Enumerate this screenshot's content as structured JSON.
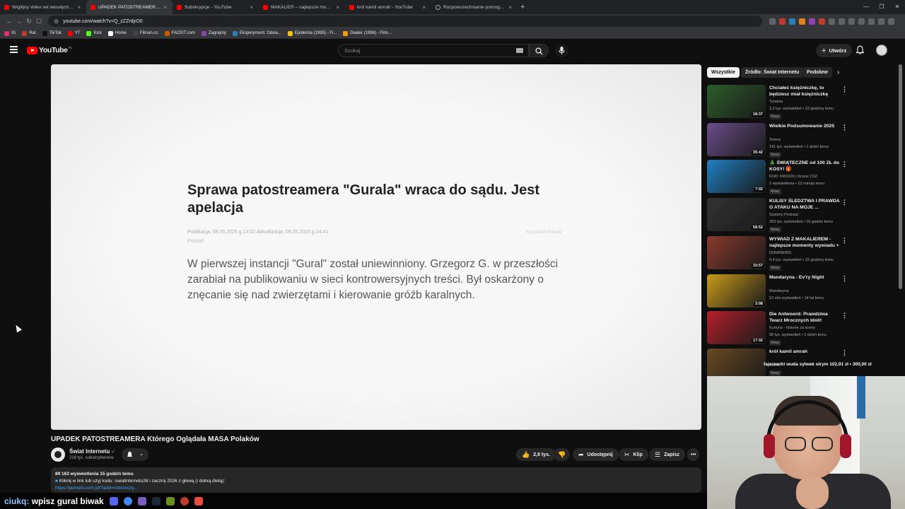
{
  "browser": {
    "tabs": [
      {
        "title": "Wigilijny video set wesołych świąt ko",
        "icon": "youtube-icon",
        "active": false
      },
      {
        "title": "UPADEK PATOSTREAMERA Kt",
        "icon": "youtube-icon",
        "active": true
      },
      {
        "title": "Subskrypcje - YouTube",
        "icon": "youtube-icon",
        "active": false
      },
      {
        "title": "MAKALIER – najlepsze momenty wyw",
        "icon": "youtube-icon",
        "active": false
      },
      {
        "title": "król kamil amrah - YouTube",
        "icon": "youtube-icon",
        "active": false
      },
      {
        "title": "Rozpowszechnianie pornografii dzie",
        "icon": "globe-icon",
        "active": false
      }
    ],
    "url": "youtube.com/watch?v=Q_zZZrdjrO0",
    "bookmarks": [
      "IG",
      "Rat",
      "TikTok",
      "YT",
      "Kick",
      "Home",
      "Filman.cc",
      "FACEIT.com",
      "Zagrajmy",
      "Eksperyment: Odsia...",
      "Epidemia (1995) - Fi...",
      "Dealer (1996) - Film..."
    ]
  },
  "youtube": {
    "logo_text": "YouTube",
    "country_code": "PL",
    "search_placeholder": "Szukaj",
    "create_label": "Utwórz"
  },
  "video": {
    "frame": {
      "headline": "Sprawa patostreamera \"Gurala\" wraca do sądu. Jest apelacja",
      "meta": "Publikacja: 08.05.2025 g.13:02  Aktualizacja: 08.05.2025 g.14:41",
      "source": "Krzysztof Polaski",
      "city": "Poznań",
      "lead": "W pierwszej instancji \"Gural\" został uniewinniony. Grzegorz G. w przeszłości zarabiał na publikowaniu w sieci kontrowersyjnych treści. Był oskarżony o znęcanie się nad zwierzętami i kierowanie gróźb karalnych."
    },
    "title": "UPADEK PATOSTREAMERA Którego Oglądała MASA Polaków",
    "channel": "Świat Internetu",
    "subscribers": "216 tys. subskrybentów",
    "likes": "2,9 tys.",
    "share_label": "Udostępnij",
    "clip_label": "Klip",
    "save_label": "Zapisz",
    "views_line": "89 163 wyświetlenia  15 godzin temu",
    "promo_line": "Kliknij w link lub użyj kodu: swiatinternetu26  i zacznij 2026 z głową (i dobrą dietą):",
    "promo_link": "https://pomelo.com.pl/?adid=robrzeczy..."
  },
  "chips": [
    "Wszystkie",
    "Źródło: Świat Internetu",
    "Podobne"
  ],
  "recommendations": [
    {
      "title": "Chciałeś księżniczkę, to będziesz miał księżniczkę",
      "channel": "Tyrainia",
      "meta": "2,2 tys. wyświetleń • 23 godziny temu",
      "badge": "Nowy",
      "duration": "18:37",
      "color": "#2b5d2b"
    },
    {
      "title": "Wielkie Podsumowanie 2025",
      "channel": "Tomes",
      "meta": "191 tys. wyświetleń • 1 dzień temu",
      "badge": "Nowy",
      "duration": "35:42",
      "color": "#6a4d8a"
    },
    {
      "title": "🎄 ŚWIĄTECZNE od 100 ZŁ do KOSY! 🎁",
      "channel": "KOD: KROXXI | Kroxxi CS2",
      "meta": "2 wyświetlenia • 23 minuty temu",
      "badge": "Nowy",
      "duration": "7:02",
      "color": "#1f7fc1"
    },
    {
      "title": "KULISY ŚLEDZTWA I PRAWDA O ATAKU NA MOJE ...",
      "channel": "Szalony Podcast",
      "meta": "303 tys. wyświetleń • 16 godzin temu",
      "badge": "Nowy",
      "duration": "58:52",
      "color": "#333333"
    },
    {
      "title": "WYWIAD Z MAKALIEREM - najlepsze momenty wywiadu + ...",
      "channel": "DOMINEWS",
      "meta": "6,4 tys. wyświetleń • 22 godziny temu",
      "badge": "Nowy",
      "duration": "10:57",
      "color": "#8a3a2e"
    },
    {
      "title": "Mandaryna - Ev'ry Night",
      "channel": "Mandaryna",
      "meta": "12 mln wyświetleń • 14 lat temu",
      "badge": "",
      "duration": "3:08",
      "color": "#c99a1a"
    },
    {
      "title": "Die Antwoord: Prawdziwa Twarz Mrocznych Idoli!",
      "channel": "Kurtyna - historie za sceny",
      "meta": "96 tys. wyświetleń • 1 dzień temu",
      "badge": "Nowy",
      "duration": "17:32",
      "color": "#b3202a"
    },
    {
      "title": "król kamil amrah",
      "channel": "Carlos",
      "meta": "",
      "badge": "Nowy",
      "duration": "",
      "color": "#6a4a22"
    }
  ],
  "stream": {
    "donation": "fajerwerki wuda sylwek strym  102,91 zł  •  300,00 zł",
    "chat_user": "ciukq:",
    "chat_text": "wpisz gural biwak"
  },
  "colors": {
    "brand_red": "#ff0000",
    "link_blue": "#3ea6ff",
    "bg": "#0f0f0f"
  }
}
